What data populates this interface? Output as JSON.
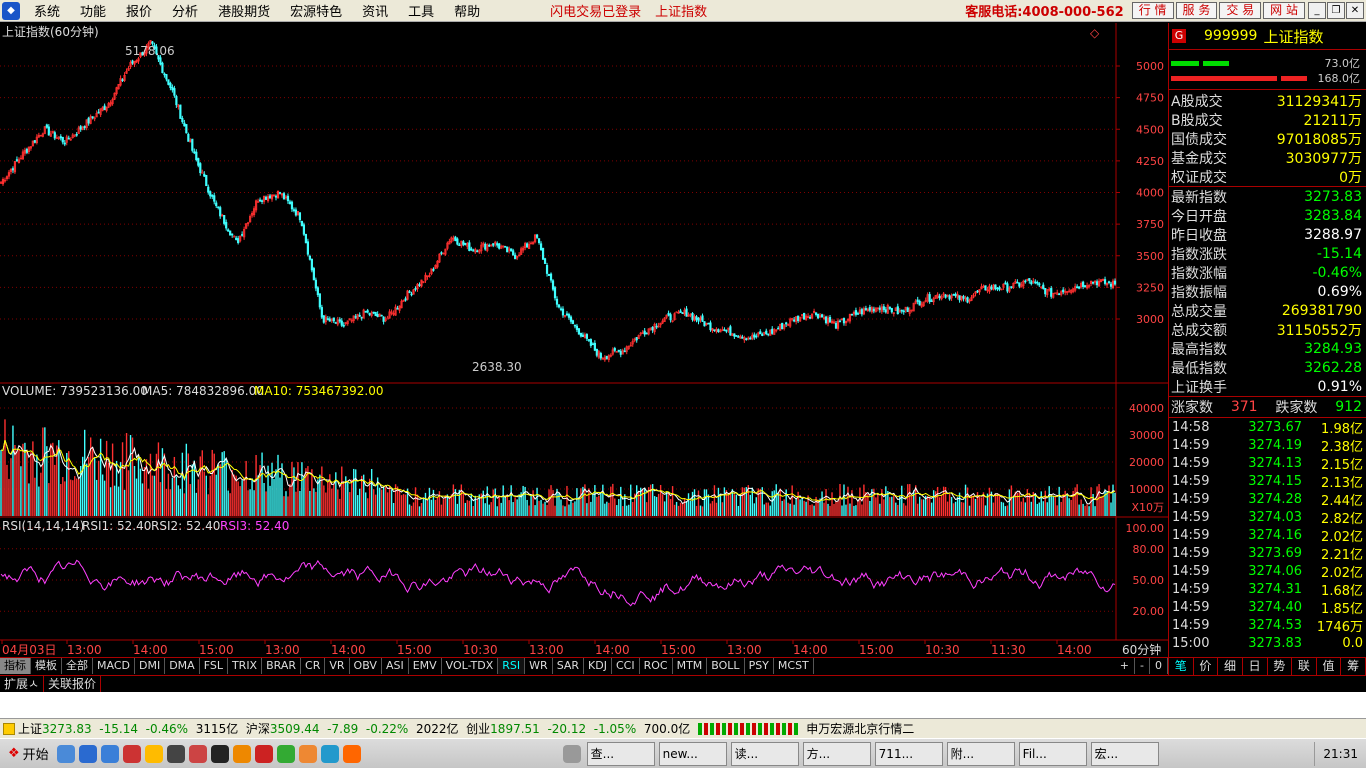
{
  "menu": {
    "items": [
      "系统",
      "功能",
      "报价",
      "分析",
      "港股期货",
      "宏源特色",
      "资讯",
      "工具",
      "帮助"
    ],
    "login_status": "闪电交易已登录",
    "index_link": "上证指数",
    "hotline": "客服电话:4008-000-562",
    "nav_buttons": [
      "行 情",
      "服 务",
      "交 易",
      "网 站"
    ],
    "window_buttons": [
      "_",
      "❐",
      "✕"
    ]
  },
  "chart": {
    "title": "上证指数(60分钟)",
    "high_label": "5178.06",
    "low_label": "2638.30",
    "price_axis": [
      "5000",
      "4750",
      "4500",
      "4250",
      "4000",
      "3750",
      "3500",
      "3250",
      "3000"
    ],
    "volume_header": {
      "label": "VOLUME: 739523136.00",
      "ma5": "MA5: 784832896.00",
      "ma10": "MA10: 753467392.00"
    },
    "volume_axis": [
      "40000",
      "30000",
      "20000",
      "10000"
    ],
    "volume_unit": "X10万",
    "rsi_header": {
      "label": "RSI(14,14,14)",
      "rsi1": "RSI1: 52.40",
      "rsi2": "RSI2: 52.40",
      "rsi3": "RSI3: 52.40"
    },
    "rsi_axis": [
      "100.00",
      "80.00",
      "50.00",
      "20.00"
    ],
    "time_axis": [
      "04月03日",
      "13:00",
      "14:00",
      "15:00",
      "13:00",
      "14:00",
      "15:00",
      "10:30",
      "13:00",
      "14:00",
      "15:00",
      "13:00",
      "14:00",
      "15:00",
      "10:30",
      "11:30",
      "14:00"
    ],
    "period": "60分钟",
    "colors": {
      "up": "#ff3030",
      "down": "#40ffff",
      "ma5": "#ffffff",
      "ma10": "#ffff00",
      "rsi": "#ff40ff",
      "grid": "#800000"
    }
  },
  "chart_data": {
    "type": "candlestick",
    "title": "上证指数(60分钟)",
    "price_range": [
      2638.3,
      5178.06
    ],
    "approx_close_path": [
      4080,
      4300,
      4500,
      4400,
      4550,
      4700,
      5000,
      5178,
      4800,
      4300,
      3900,
      3600,
      3950,
      4000,
      3800,
      3000,
      2950,
      3050,
      3000,
      3200,
      3350,
      3650,
      3550,
      3600,
      3500,
      3650,
      3100,
      2900,
      2700,
      2750,
      2900,
      3000,
      3050,
      2950,
      2900,
      2850,
      2900,
      3000,
      3050,
      2950,
      3050,
      3100,
      3050,
      3150,
      3200,
      3150,
      3250,
      3250,
      3300,
      3200,
      3250,
      3300,
      3273.83
    ],
    "volume_unit": "X10万",
    "volume_range": [
      0,
      40000
    ],
    "rsi_range": [
      0,
      100
    ],
    "last_rsi": 52.4
  },
  "right": {
    "code": "999999",
    "name": "上证指数",
    "bar1_label": "73.0亿",
    "bar2_label": "168.0亿",
    "turnover": [
      {
        "label": "A股成交",
        "value": "31129341万"
      },
      {
        "label": "B股成交",
        "value": "21211万"
      },
      {
        "label": "国债成交",
        "value": "97018085万"
      },
      {
        "label": "基金成交",
        "value": "3030977万"
      },
      {
        "label": "权证成交",
        "value": "0万"
      }
    ],
    "stats": [
      {
        "label": "最新指数",
        "value": "3273.83",
        "color": "g"
      },
      {
        "label": "今日开盘",
        "value": "3283.84",
        "color": "g"
      },
      {
        "label": "昨日收盘",
        "value": "3288.97",
        "color": "w"
      },
      {
        "label": "指数涨跌",
        "value": "-15.14",
        "color": "g"
      },
      {
        "label": "指数涨幅",
        "value": "-0.46%",
        "color": "g"
      },
      {
        "label": "指数振幅",
        "value": "0.69%",
        "color": "w"
      },
      {
        "label": "总成交量",
        "value": "269381790",
        "color": "y"
      },
      {
        "label": "总成交额",
        "value": "31150552万",
        "color": "y"
      },
      {
        "label": "最高指数",
        "value": "3284.93",
        "color": "g"
      },
      {
        "label": "最低指数",
        "value": "3262.28",
        "color": "g"
      },
      {
        "label": "上证换手",
        "value": "0.91%",
        "color": "w"
      }
    ],
    "updown": {
      "up_label": "涨家数",
      "up": "371",
      "down_label": "跌家数",
      "down": "912"
    },
    "ticks": [
      {
        "t": "14:58",
        "p": "3273.67",
        "v": "1.98亿"
      },
      {
        "t": "14:59",
        "p": "3274.19",
        "v": "2.38亿"
      },
      {
        "t": "14:59",
        "p": "3274.13",
        "v": "2.15亿"
      },
      {
        "t": "14:59",
        "p": "3274.15",
        "v": "2.13亿"
      },
      {
        "t": "14:59",
        "p": "3274.28",
        "v": "2.44亿"
      },
      {
        "t": "14:59",
        "p": "3274.03",
        "v": "2.82亿"
      },
      {
        "t": "14:59",
        "p": "3274.16",
        "v": "2.02亿"
      },
      {
        "t": "14:59",
        "p": "3273.69",
        "v": "2.21亿"
      },
      {
        "t": "14:59",
        "p": "3274.06",
        "v": "2.02亿"
      },
      {
        "t": "14:59",
        "p": "3274.31",
        "v": "1.68亿"
      },
      {
        "t": "14:59",
        "p": "3274.40",
        "v": "1.85亿"
      },
      {
        "t": "14:59",
        "p": "3274.53",
        "v": "1746万"
      },
      {
        "t": "15:00",
        "p": "3273.83",
        "v": "0.0"
      }
    ],
    "tabs": [
      "笔",
      "价",
      "细",
      "日",
      "势",
      "联",
      "值",
      "筹"
    ]
  },
  "indicators": [
    "指标",
    "模板",
    "全部",
    "MACD",
    "DMI",
    "DMA",
    "FSL",
    "TRIX",
    "BRAR",
    "CR",
    "VR",
    "OBV",
    "ASI",
    "EMV",
    "VOL-TDX",
    "RSI",
    "WR",
    "SAR",
    "KDJ",
    "CCI",
    "ROC",
    "MTM",
    "BOLL",
    "PSY",
    "MCST"
  ],
  "indicator_ctrl": [
    "+",
    "-",
    "0"
  ],
  "ext_tabs": [
    "扩展ㅅ",
    "关联报价"
  ],
  "status": {
    "sh_label": "上证",
    "sh_val": "3273.83",
    "sh_chg": "-15.14",
    "sh_pct": "-0.46%",
    "sh_amt": "3115亿",
    "sz_label": "沪深",
    "sz_val": "3509.44",
    "sz_chg": "-7.89",
    "sz_pct": "-0.22%",
    "sz_amt": "2022亿",
    "cy_label": "创业",
    "cy_val": "1897.51",
    "cy_chg": "-20.12",
    "cy_pct": "-1.05%",
    "cy_amt": "700.0亿",
    "server": "申万宏源北京行情二"
  },
  "taskbar": {
    "start": "开始",
    "tasks": [
      "查...",
      "new...",
      "读...",
      "方...",
      "711...",
      "附...",
      "Fil...",
      "宏..."
    ],
    "clock": "21:31"
  }
}
